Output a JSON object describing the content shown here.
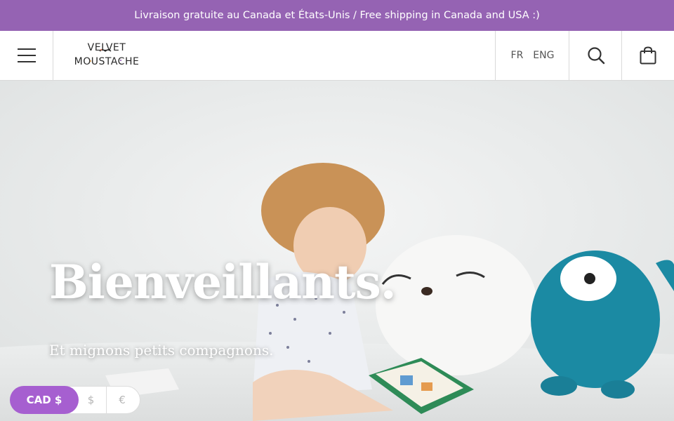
{
  "announcement": {
    "text": "Livraison gratuite au Canada et États-Unis / Free shipping in Canada and USA :)"
  },
  "header": {
    "logo": {
      "line1": "VELVET",
      "line2": "MOUSTACHE"
    },
    "languages": [
      "FR",
      "ENG"
    ],
    "icons": {
      "menu": "hamburger-menu-icon",
      "search": "search-icon",
      "cart": "shopping-bag-icon"
    }
  },
  "hero": {
    "title": "Bienveillants.",
    "subtitle": "Et mignons petits compagnons."
  },
  "currency": {
    "active": "CAD $",
    "options": [
      "$",
      "€"
    ]
  },
  "colors": {
    "announcement_bg": "#9563b3",
    "currency_active_bg": "#a65fd0",
    "monster_teal": "#1b8aa3"
  }
}
